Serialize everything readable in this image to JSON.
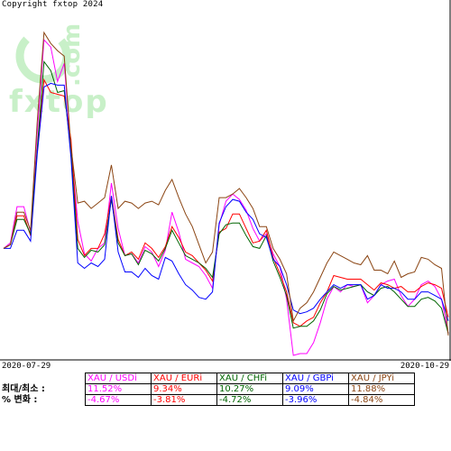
{
  "copyright": "Copyright fxtop 2024",
  "watermark": {
    "logo_text": "fxtop",
    "side_text": ".com",
    "color": "#c8f0c8"
  },
  "dates": {
    "start": "2020-07-29",
    "end": "2020-10-29"
  },
  "table": {
    "row_labels": {
      "minmax": "최대/최소 :",
      "change": "% 변화 :"
    },
    "columns": [
      {
        "label": "XAU / USDi",
        "max": "11.52%",
        "change": "-4.67%",
        "color": "#ff00ff"
      },
      {
        "label": "XAU / EURi",
        "max": "9.34%",
        "change": "-3.81%",
        "color": "#ff0000"
      },
      {
        "label": "XAU / CHFi",
        "max": "10.27%",
        "change": "-4.72%",
        "color": "#006400"
      },
      {
        "label": "XAU / GBPi",
        "max": "9.09%",
        "change": "-3.96%",
        "color": "#0000ff"
      },
      {
        "label": "XAU / JPYi",
        "max": "11.88%",
        "change": "-4.84%",
        "color": "#8b4513"
      }
    ]
  },
  "chart_data": {
    "type": "line",
    "x_start": "2020-07-29",
    "x_end": "2020-10-29",
    "ylim": [
      -6,
      13
    ],
    "grid": false,
    "series": [
      {
        "name": "XAU / USDi",
        "color": "#ff00ff",
        "values": [
          0.0,
          0.3,
          2.3,
          2.3,
          0.9,
          6.4,
          11.5,
          11.1,
          9.2,
          10.2,
          5.4,
          1.5,
          -0.3,
          -0.7,
          0.0,
          0.3,
          3.6,
          1.1,
          -0.4,
          -0.3,
          -0.8,
          0.1,
          -0.2,
          -1.0,
          -0.1,
          2.0,
          0.9,
          -0.6,
          -0.8,
          -1.0,
          -1.5,
          -2.2,
          1.3,
          2.6,
          3.0,
          2.7,
          2.1,
          1.1,
          0.4,
          0.8,
          -0.3,
          -1.0,
          -2.8,
          -5.9,
          -5.8,
          -5.8,
          -5.2,
          -4.1,
          -2.8,
          -2.1,
          -2.4,
          -2.0,
          -2.1,
          -2.0,
          -3.0,
          -2.6,
          -2.0,
          -1.8,
          -1.7,
          -2.6,
          -3.2,
          -2.8,
          -2.0,
          -1.8,
          -2.1,
          -2.8,
          -4.7
        ]
      },
      {
        "name": "XAU / EURi",
        "color": "#ff0000",
        "values": [
          0.0,
          0.2,
          1.8,
          1.8,
          0.7,
          5.4,
          9.3,
          8.6,
          8.5,
          8.4,
          6.0,
          0.5,
          -0.4,
          0.0,
          0.0,
          0.8,
          2.9,
          0.5,
          -0.4,
          -0.2,
          -0.6,
          0.3,
          0.0,
          -0.5,
          0.1,
          1.2,
          0.6,
          -0.2,
          -0.4,
          -0.8,
          -1.2,
          -1.8,
          0.9,
          1.1,
          1.9,
          1.9,
          1.1,
          0.3,
          0.4,
          1.0,
          -0.5,
          -1.4,
          -2.4,
          -4.1,
          -4.3,
          -4.0,
          -3.8,
          -3.0,
          -2.4,
          -1.5,
          -1.6,
          -1.7,
          -1.7,
          -1.7,
          -2.0,
          -2.3,
          -1.9,
          -2.0,
          -2.2,
          -2.1,
          -2.4,
          -2.4,
          -2.1,
          -1.9,
          -2.0,
          -2.2,
          -3.8
        ]
      },
      {
        "name": "XAU / CHFi",
        "color": "#006400",
        "values": [
          0.0,
          0.2,
          1.6,
          1.6,
          0.8,
          5.5,
          10.3,
          9.8,
          8.6,
          8.7,
          5.3,
          0.0,
          -0.5,
          -0.1,
          -0.2,
          0.2,
          2.7,
          0.3,
          -0.4,
          -0.3,
          -0.9,
          -0.1,
          -0.3,
          -0.7,
          0.0,
          1.0,
          0.3,
          -0.4,
          -0.6,
          -0.8,
          -1.1,
          -1.6,
          0.8,
          1.3,
          1.4,
          1.4,
          0.7,
          0.1,
          0.0,
          0.7,
          -0.7,
          -1.6,
          -2.6,
          -4.4,
          -4.3,
          -4.3,
          -4.0,
          -3.4,
          -2.5,
          -2.1,
          -2.3,
          -2.2,
          -2.1,
          -2.0,
          -2.4,
          -2.6,
          -2.2,
          -2.1,
          -2.4,
          -2.8,
          -3.2,
          -3.2,
          -2.8,
          -2.7,
          -2.9,
          -3.3,
          -4.7
        ]
      },
      {
        "name": "XAU / GBPi",
        "color": "#0000ff",
        "values": [
          0.0,
          0.0,
          1.0,
          1.0,
          0.4,
          5.2,
          8.9,
          9.1,
          9.0,
          9.0,
          5.0,
          -0.8,
          -1.1,
          -0.8,
          -1.0,
          -0.6,
          2.9,
          -0.2,
          -1.3,
          -1.3,
          -1.6,
          -1.1,
          -1.5,
          -1.7,
          -0.5,
          -0.7,
          -1.4,
          -2.0,
          -2.3,
          -2.7,
          -2.8,
          -2.4,
          1.4,
          2.3,
          2.7,
          2.6,
          2.0,
          1.6,
          0.8,
          0.6,
          -0.6,
          -1.0,
          -2.0,
          -3.4,
          -3.6,
          -3.5,
          -3.3,
          -2.8,
          -2.4,
          -2.0,
          -2.2,
          -2.0,
          -2.0,
          -2.0,
          -2.8,
          -2.6,
          -2.0,
          -2.2,
          -2.2,
          -2.4,
          -2.8,
          -2.8,
          -2.4,
          -2.4,
          -2.6,
          -2.8,
          -4.0
        ]
      },
      {
        "name": "XAU / JPYi",
        "color": "#8b4513",
        "values": [
          0.0,
          0.2,
          2.0,
          2.0,
          1.0,
          7.0,
          11.9,
          11.3,
          10.9,
          10.6,
          5.6,
          2.5,
          2.6,
          2.2,
          2.5,
          2.8,
          4.6,
          2.2,
          2.6,
          2.5,
          2.2,
          2.5,
          2.6,
          2.4,
          3.2,
          3.8,
          2.8,
          1.9,
          1.2,
          0.2,
          -0.8,
          -0.2,
          2.8,
          2.8,
          3.0,
          3.3,
          2.8,
          2.2,
          1.2,
          1.2,
          0.0,
          -0.6,
          -1.4,
          -4.0,
          -3.3,
          -3.0,
          -2.4,
          -1.6,
          -0.8,
          -0.2,
          -0.4,
          -0.6,
          -0.8,
          -0.9,
          -0.4,
          -1.2,
          -1.2,
          -1.4,
          -0.7,
          -1.6,
          -1.4,
          -1.3,
          -0.5,
          -0.6,
          -0.9,
          -1.1,
          -4.8
        ]
      }
    ]
  }
}
